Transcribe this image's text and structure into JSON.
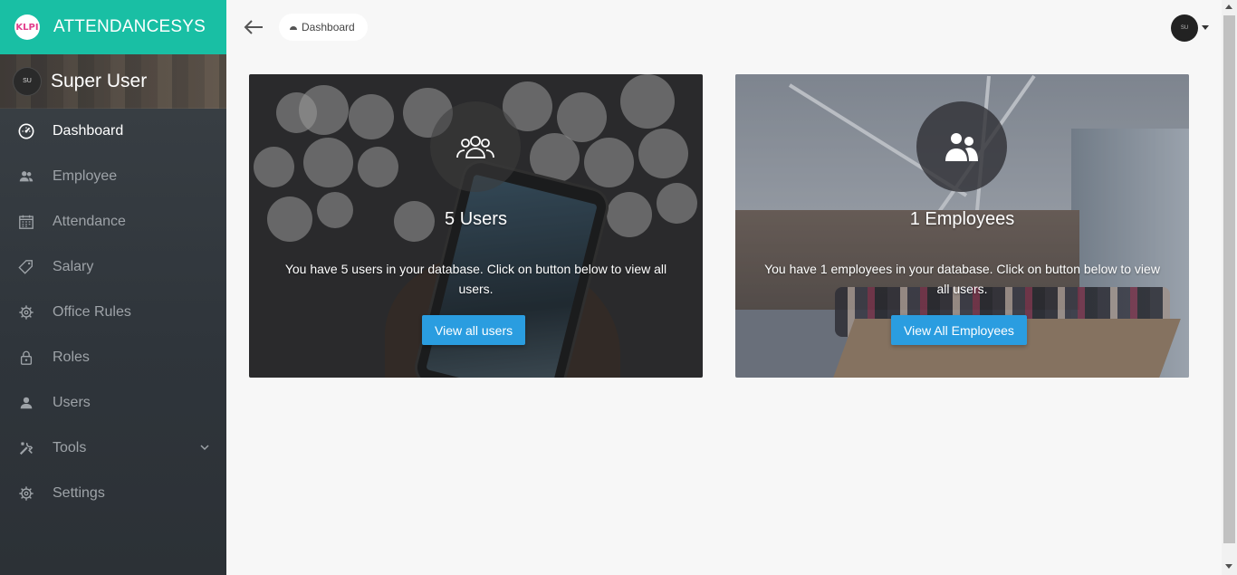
{
  "brand": {
    "logo_text": "KLPI",
    "name": "ATTENDANCESYS"
  },
  "user": {
    "avatar_initials": "SU",
    "name": "Super User"
  },
  "sidebar": {
    "items": [
      {
        "label": "Dashboard",
        "icon": "dashboard-icon",
        "active": true
      },
      {
        "label": "Employee",
        "icon": "employee-icon"
      },
      {
        "label": "Attendance",
        "icon": "calendar-icon"
      },
      {
        "label": "Salary",
        "icon": "tag-icon"
      },
      {
        "label": "Office Rules",
        "icon": "gear-icon"
      },
      {
        "label": "Roles",
        "icon": "lock-icon"
      },
      {
        "label": "Users",
        "icon": "user-icon"
      },
      {
        "label": "Tools",
        "icon": "tools-icon",
        "has_submenu": true
      },
      {
        "label": "Settings",
        "icon": "gear-icon"
      }
    ]
  },
  "topbar": {
    "breadcrumb": "Dashboard",
    "avatar_initials": "SU"
  },
  "cards": {
    "users": {
      "title": "5 Users",
      "description": "You have 5 users in your database. Click on button below to view all users.",
      "button": "View all users",
      "icon": "users-group-icon"
    },
    "employees": {
      "title": "1 Employees",
      "description": "You have 1 employees in your database. Click on button below to view all users.",
      "button": "View All Employees",
      "icon": "employees-icon"
    }
  },
  "colors": {
    "brand": "#19bfa4",
    "sidebar": "#2f353b",
    "button": "#2a9de0",
    "background": "#f7f7f7"
  }
}
